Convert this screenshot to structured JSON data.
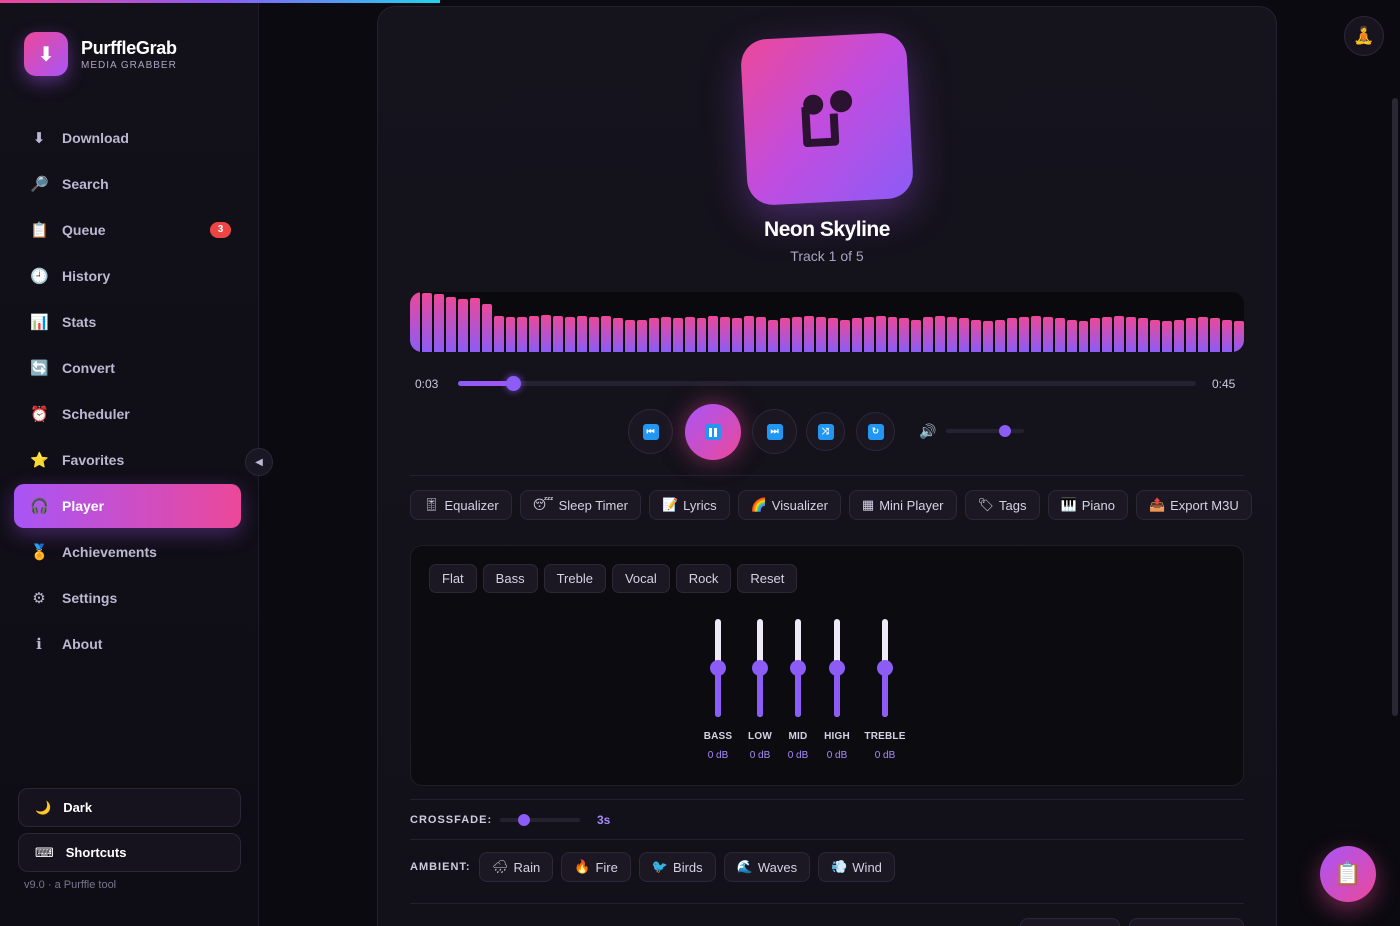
{
  "brand": {
    "name": "PurffleGrab",
    "subtitle": "MEDIA GRABBER",
    "logo_icon": "download-arrow"
  },
  "sidebar": {
    "items": [
      {
        "label": "Download",
        "icon": "⬇"
      },
      {
        "label": "Search",
        "icon": "🔎"
      },
      {
        "label": "Queue",
        "icon": "📋",
        "badge": "3"
      },
      {
        "label": "History",
        "icon": "🕘"
      },
      {
        "label": "Stats",
        "icon": "📊"
      },
      {
        "label": "Convert",
        "icon": "🔄"
      },
      {
        "label": "Scheduler",
        "icon": "⏰"
      },
      {
        "label": "Favorites",
        "icon": "⭐"
      },
      {
        "label": "Player",
        "icon": "🎧",
        "active": true
      },
      {
        "label": "Achievements",
        "icon": "🏅"
      },
      {
        "label": "Settings",
        "icon": "⚙"
      },
      {
        "label": "About",
        "icon": "ℹ"
      }
    ],
    "theme_button": {
      "label": "Dark",
      "icon": "🌙"
    },
    "shortcuts_button": {
      "label": "Shortcuts",
      "icon": "⌨"
    },
    "version": "v9.0 · a Purffle tool",
    "collapse_icon": "◀"
  },
  "player": {
    "title": "Neon Skyline",
    "subtitle": "Track 1 of 5",
    "elapsed": "0:03",
    "duration": "0:45",
    "progress": 0.075,
    "volume": 0.75,
    "waveform": [
      100,
      98,
      96,
      92,
      88,
      90,
      80,
      60,
      58,
      58,
      60,
      62,
      60,
      58,
      60,
      58,
      60,
      56,
      54,
      54,
      56,
      58,
      56,
      58,
      56,
      60,
      58,
      56,
      60,
      58,
      54,
      56,
      58,
      60,
      58,
      56,
      54,
      56,
      58,
      60,
      58,
      56,
      54,
      58,
      60,
      58,
      56,
      54,
      52,
      54,
      56,
      58,
      60,
      58,
      56,
      54,
      52,
      56,
      58,
      60,
      58,
      56,
      54,
      52,
      54,
      56,
      58,
      56,
      54,
      52
    ]
  },
  "tools": [
    {
      "label": "Equalizer",
      "icon": "🎚"
    },
    {
      "label": "Sleep Timer",
      "icon": "😴"
    },
    {
      "label": "Lyrics",
      "icon": "📝"
    },
    {
      "label": "Visualizer",
      "icon": "🌈"
    },
    {
      "label": "Mini Player",
      "icon": "▦"
    },
    {
      "label": "Tags",
      "icon": "🏷"
    },
    {
      "label": "Piano",
      "icon": "🎹"
    },
    {
      "label": "Export M3U",
      "icon": "📤"
    }
  ],
  "equalizer": {
    "presets": [
      "Flat",
      "Bass",
      "Treble",
      "Vocal",
      "Rock",
      "Reset"
    ],
    "bands": [
      {
        "label": "BASS",
        "value": "0 dB",
        "level": 0.5
      },
      {
        "label": "LOW",
        "value": "0 dB",
        "level": 0.5
      },
      {
        "label": "MID",
        "value": "0 dB",
        "level": 0.5
      },
      {
        "label": "HIGH",
        "value": "0 dB",
        "level": 0.5
      },
      {
        "label": "TREBLE",
        "value": "0 dB",
        "level": 0.5
      }
    ]
  },
  "crossfade": {
    "label": "CROSSFADE:",
    "value": "3s",
    "level": 0.3
  },
  "ambient": {
    "label": "AMBIENT:",
    "sounds": [
      {
        "label": "Rain",
        "icon": "🌧"
      },
      {
        "label": "Fire",
        "icon": "🔥"
      },
      {
        "label": "Birds",
        "icon": "🐦"
      },
      {
        "label": "Waves",
        "icon": "🌊"
      },
      {
        "label": "Wind",
        "icon": "💨"
      }
    ]
  },
  "header": {
    "avatar_icon": "🧘"
  },
  "fab": {
    "icon": "📋"
  },
  "colors": {
    "accent_purple": "#a855f7",
    "accent_pink": "#ec4899",
    "slider": "#8b5cf6"
  }
}
